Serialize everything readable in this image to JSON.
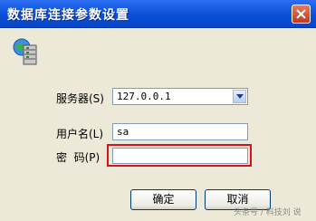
{
  "window": {
    "title": "数据库连接参数设置",
    "colors": {
      "titlebar": "#0a4fd6",
      "highlight": "#d9111a",
      "background": "#ece9d8"
    }
  },
  "icons": {
    "close": "close-icon",
    "database": "database-icon",
    "dropdown": "chevron-down-icon"
  },
  "form": {
    "server_label": "服务器(S)",
    "server_value": "127.0.0.1",
    "username_label": "用户名(L)",
    "username_value": "sa",
    "password_label": "密  码(P)",
    "password_value": ""
  },
  "buttons": {
    "ok_label": "确定",
    "cancel_label": "取消"
  },
  "watermark": "头条号 / 科技刘 说"
}
